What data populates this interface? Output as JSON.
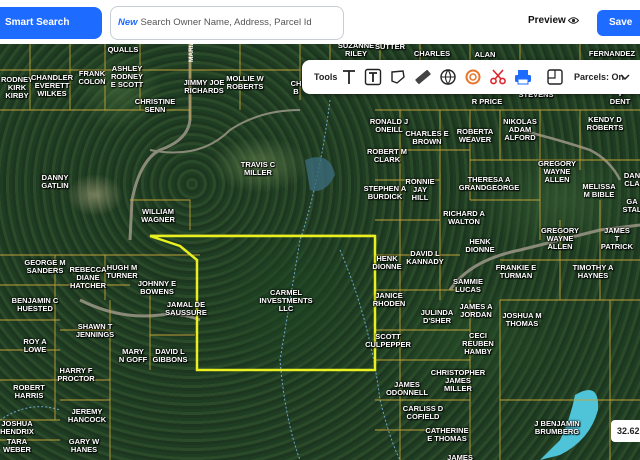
{
  "toolbar": {
    "smart_search_label": "Smart Search",
    "search_new_badge": "New",
    "search_placeholder": "Search Owner Name, Address, Parcel Id",
    "preview_label": "Preview",
    "save_label": "Save"
  },
  "tools": {
    "label": "Tools",
    "items": [
      "text-tool-icon",
      "text-box-tool-icon",
      "polygon-tool-icon",
      "ruler-icon",
      "globe-icon",
      "circle-tool-icon",
      "scissors-icon",
      "print-icon",
      "parcel-layer-icon"
    ],
    "parcels_label": "Parcels: On"
  },
  "map": {
    "scale_readout": "32.62",
    "highlight_color": "#e8f020",
    "parcel_line_color": "#c8a63a",
    "road_label": "MARIA L",
    "owners": [
      "QUALLS",
      "SUZANNE\nRILEY",
      "SUTTER",
      "CHARLES",
      "ALAN",
      "FERNANDEZ",
      "RODNEY\nKIRK\nKIRBY",
      "CHANDLER\nEVERETT\nWILKES",
      "FRANK\nCOLON",
      "ASHLEY\nRODNEY\nE SCOTT",
      "JIMMY JOE\nRICHARDS",
      "MOLLIE W\nROBERTS",
      "CH\nB",
      "R PRICE",
      "STEVENS",
      "V DENT",
      "CHRISTINE\nSENN",
      "RONALD J\nONEILL",
      "CHARLES E\nBROWN",
      "ROBERTA\nWEAVER",
      "NIKOLAS\nADAM\nALFORD",
      "KENDY D\nROBERTS",
      "TRAVIS C\nMILLER",
      "ROBERT M\nCLARK",
      "GREGORY\nWAYNE\nALLEN",
      "DANNY\nGATLIN",
      "RONNIE\nJAY\nHILL",
      "THERESA A\nGRANDGEORGE",
      "MELISSA\nM BIBLE",
      "DAN\nCLA",
      "STEPHEN A\nBURDICK",
      "GA\nSTAL",
      "WILLIAM\nWAGNER",
      "RICHARD A\nWALTON",
      "HENK\nDIONNE",
      "GREGORY\nWAYNE\nALLEN",
      "JAMES T\nPATRICK",
      "GEORGE M\nSANDERS",
      "HENK\nDIONNE",
      "DAVID L\nKANNADY",
      "FRANKIE E\nTURMAN",
      "TIMOTHY A\nHAYNES",
      "REBECCA\nDIANE\nHATCHER",
      "HUGH M\nTURNER",
      "JOHNNY E\nBOWENS",
      "CARMEL\nINVESTMENTS\nLLC",
      "SAMMIE\nLUCAS",
      "BENJAMIN C\nHUESTED",
      "JAMAL DE\nSAUSSURE",
      "JANICE\nRHODEN",
      "JULINDA\nD'SHER",
      "JAMES A\nJORDAN",
      "JOSHUA M\nTHOMAS",
      "SHAWN T\nJENNINGS",
      "ROY A\nLOWE",
      "MARY\nN GOFF",
      "DAVID L\nGIBBONS",
      "SCOTT\nCULPEPPER",
      "CECI\nREUBEN\nHAMBY",
      "HARRY F\nPROCTOR",
      "CHRISTOPHER\nJAMES\nMILLER",
      "ROBERT\nHARRIS",
      "JAMES\nODONNELL",
      "JEREMY\nHANCOCK",
      "CARLISS D\nCOFIELD",
      "JOSHUA\nHENDRIX",
      "J BENJAMIN\nBRUMBERG",
      "CATHERINE\nE THOMAS",
      "TARA\nWEBER",
      "GARY W\nHANES",
      "JAMES"
    ]
  }
}
